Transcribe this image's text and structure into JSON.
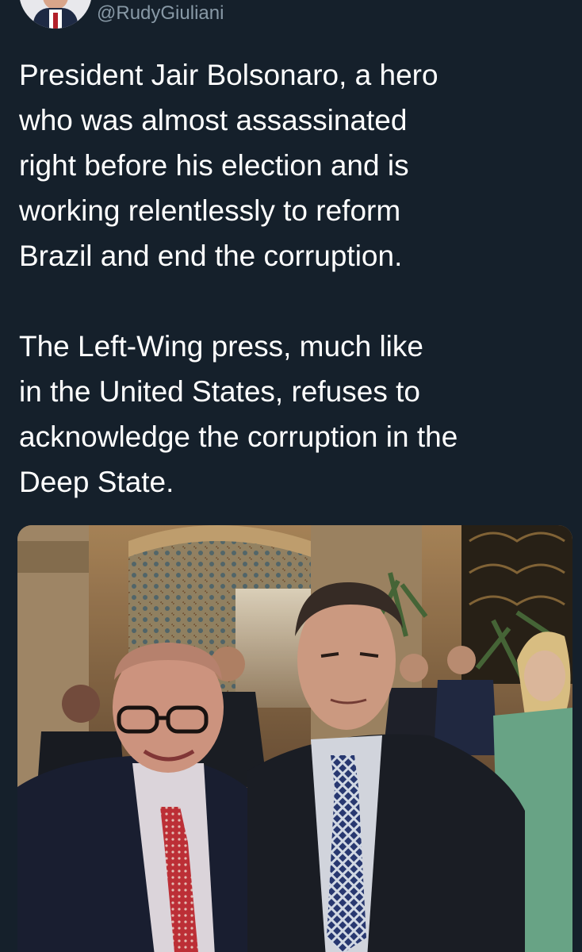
{
  "tweet": {
    "handle": "@RudyGiuliani",
    "lines": [
      "President Jair Bolsonaro, a hero",
      "who was almost assassinated",
      "right before his election and is",
      "working relentlessly to reform",
      "Brazil and end the corruption."
    ],
    "lines2": [
      "The Left-Wing press, much like",
      "in the United States, refuses to",
      "acknowledge the corruption in the",
      "Deep State."
    ]
  },
  "colors": {
    "background": "#15202b",
    "text": "#ffffff",
    "handle": "#8899a6"
  },
  "icons": {
    "avatar": "profile-photo"
  }
}
